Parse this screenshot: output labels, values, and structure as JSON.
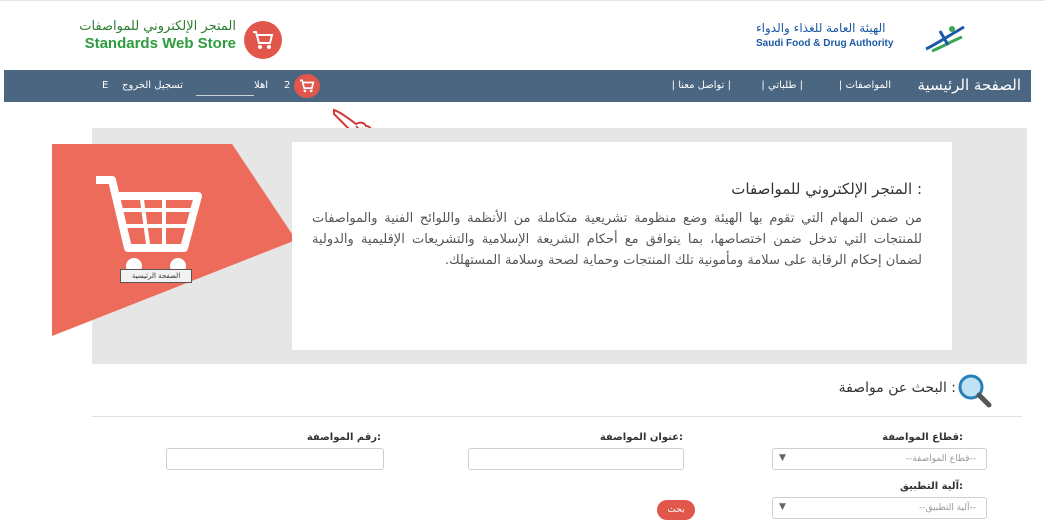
{
  "header": {
    "store_title_ar": "المتجر الإلكتروني للمواصفات",
    "store_title_en": "Standards Web Store",
    "authority_ar": "الهيئة العامة للغذاء والدواء",
    "authority_en": "Saudi Food & Drug Authority"
  },
  "nav": {
    "home": "الصفحة الرئيسية",
    "links": [
      "| المواصفات",
      "| طلباتي |",
      "| تواصل معنا |"
    ],
    "cart_count": "2",
    "welcome": "اهلا",
    "logout": "تسجيل الخروج",
    "lang": "E"
  },
  "hero": {
    "title": "المتجر الإلكتروني للمواصفات :",
    "body": "من ضمن المهام التي تقوم بها الهيئة وضع منظومة تشريعية متكاملة من الأنظمة واللوائح الفنية والمواصفات للمنتجات التي تدخل ضمن اختصاصها، بما يتوافق مع أحكام الشريعة الإسلامية والتشريعات الإقليمية والدولية لضمان إحكام الرقابة على سلامة ومأمونية تلك المنتجات وحماية لصحة وسلامة المستهلك.",
    "home_tooltip": "الصفحة الرئيسية"
  },
  "search": {
    "title": "البحث عن مواصفة :",
    "sector_label": "قطاع المواصفة:",
    "sector_placeholder": "--قطاع المواصفة--",
    "title_label": "عنوان المواصفة:",
    "number_label": "رقم المواصفة:",
    "mechanism_label": "آلية التطبيق:",
    "mechanism_placeholder": "--آلية التطبيق--",
    "button": "بحث"
  },
  "colors": {
    "nav_bg": "#4b6680",
    "accent_red": "#e2574c",
    "store_green": "#2e9c3c",
    "authority_blue": "#1c5aa6"
  }
}
